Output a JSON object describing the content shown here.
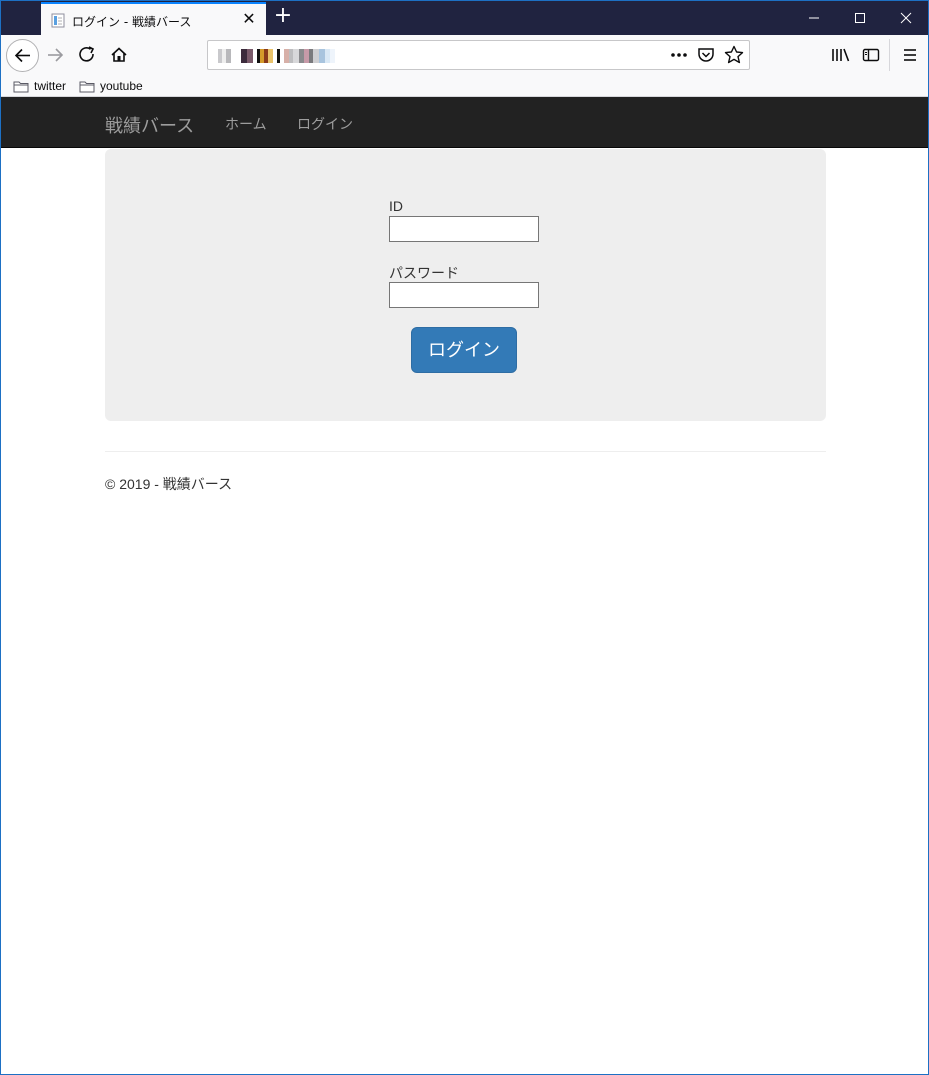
{
  "browser": {
    "tab": {
      "title": "ログイン - 戦績バース"
    },
    "new_tab_label": "+",
    "bookmarks": [
      {
        "label": "twitter",
        "icon": "folder-icon"
      },
      {
        "label": "youtube",
        "icon": "folder-icon"
      }
    ],
    "colors": {
      "titlebar": "#202340",
      "toolbar": "#f9f9fa",
      "accent": "#0a84ff"
    }
  },
  "site": {
    "brand": "戦績バース",
    "nav": [
      {
        "label": "ホーム"
      },
      {
        "label": "ログイン"
      }
    ],
    "form": {
      "id_label": "ID",
      "id_value": "",
      "password_label": "パスワード",
      "password_value": "",
      "submit_label": "ログイン"
    },
    "footer": "© 2019 - 戦績バース",
    "colors": {
      "navbar": "#222222",
      "jumbotron": "#eeeeee",
      "primary_button": "#337ab7"
    }
  }
}
